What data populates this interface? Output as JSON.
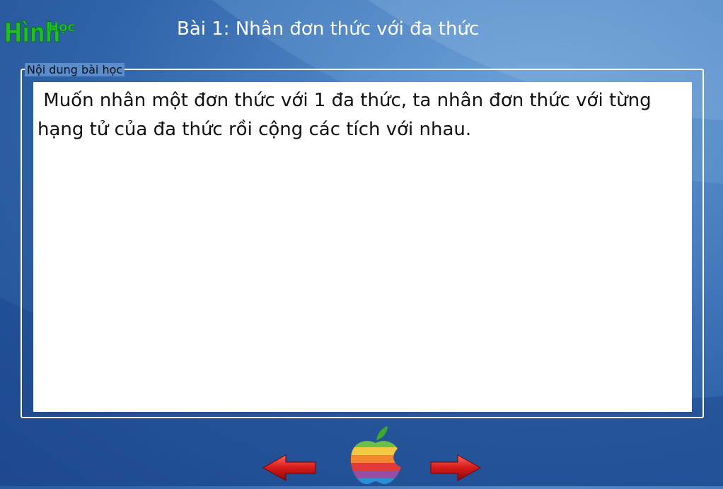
{
  "logo": {
    "text_main": "Hình",
    "text_small": "Học"
  },
  "header": {
    "title": "Bài 1: Nhân đơn thức với đa thức"
  },
  "lesson": {
    "group_label": "Nội dung bài học",
    "content": " Muốn nhân một đơn thức với 1 đa thức, ta nhân đơn thức với từng hạng tử của đa thức rồi cộng các tích với nhau."
  },
  "nav": {
    "prev_icon": "left-arrow-icon",
    "home_icon": "rainbow-apple-icon",
    "next_icon": "right-arrow-icon"
  },
  "colors": {
    "background": "#2f62a8",
    "arrow": "#d61a1a",
    "logo_green": "#1fbf2a"
  }
}
